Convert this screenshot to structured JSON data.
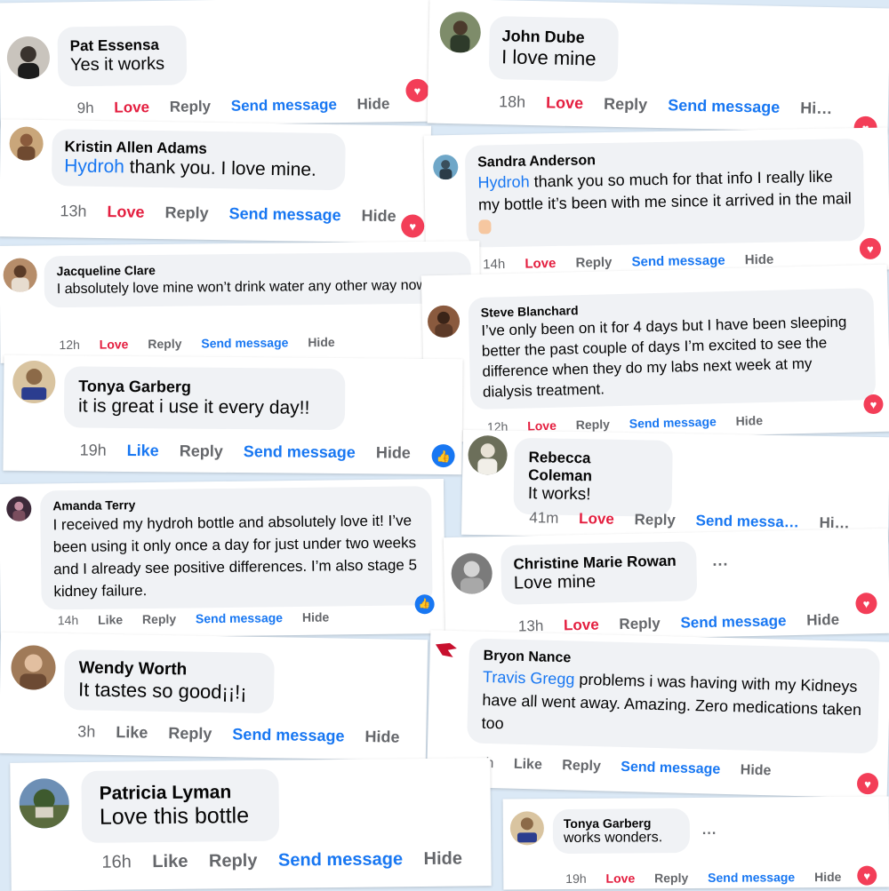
{
  "actions": {
    "love": "Love",
    "like": "Like",
    "reply": "Reply",
    "send": "Send message",
    "hide": "Hide",
    "send_cut": "Send messa…",
    "hide_cut": "Hi…"
  },
  "more_label": "...",
  "colors": {
    "background": "#dbe9f6",
    "love": "#e41e3f",
    "link": "#1877f2",
    "bubble": "#f0f2f5"
  },
  "reaction_icons": {
    "love": "heart-icon",
    "like": "thumbs-up-icon"
  },
  "comments": {
    "c1": {
      "name": "Pat Essensa",
      "text": "Yes it works",
      "time": "9h"
    },
    "c2": {
      "name": "John Dube",
      "text": "I love mine",
      "time": "18h"
    },
    "c3": {
      "name": "Kristin Allen Adams",
      "tag": "Hydroh",
      "text": " thank you. I love mine.",
      "time": "13h"
    },
    "c4": {
      "name": "Sandra Anderson",
      "tag": "Hydroh",
      "text": " thank you so much for that info I really like my bottle it’s been with me since it arrived in the mail",
      "time": "14h"
    },
    "c5": {
      "name": "Jacqueline Clare",
      "text": "I absolutely love mine won’t drink water any other way now!!!",
      "time": "12h"
    },
    "c6": {
      "name": "Steve Blanchard",
      "text": "I’ve only been on it for 4 days but I have been sleeping better the past couple of days I’m excited to see the difference when they do my labs next week at my dialysis treatment.",
      "time": "12h"
    },
    "c7": {
      "name": "Tonya Garberg",
      "text": "it is great i use it every day!!",
      "time": "19h"
    },
    "c8": {
      "name": "Rebecca Coleman",
      "text": "It works!",
      "time": "41m"
    },
    "c9": {
      "name": "Amanda Terry",
      "text": "I received my hydroh bottle and absolutely love it! I’ve been using it only once a day for just under two weeks and I already see positive differences. I’m also stage 5 kidney failure.",
      "time": "14h"
    },
    "c10": {
      "name": "Christine Marie Rowan",
      "text": "Love mine",
      "time": "13h"
    },
    "c11": {
      "name": "Wendy Worth",
      "text": "It tastes so good¡¡!¡",
      "time": "3h"
    },
    "c12": {
      "name": "Bryon Nance",
      "tag": "Travis Gregg",
      "text": " problems i was having with my Kidneys have all went away. Amazing. Zero medications taken too",
      "time": "h"
    },
    "c13": {
      "name": "Patricia Lyman",
      "text": "Love this bottle",
      "time": "16h"
    },
    "c14": {
      "name": "Tonya Garberg",
      "text": "works wonders.",
      "time": "19h"
    }
  }
}
